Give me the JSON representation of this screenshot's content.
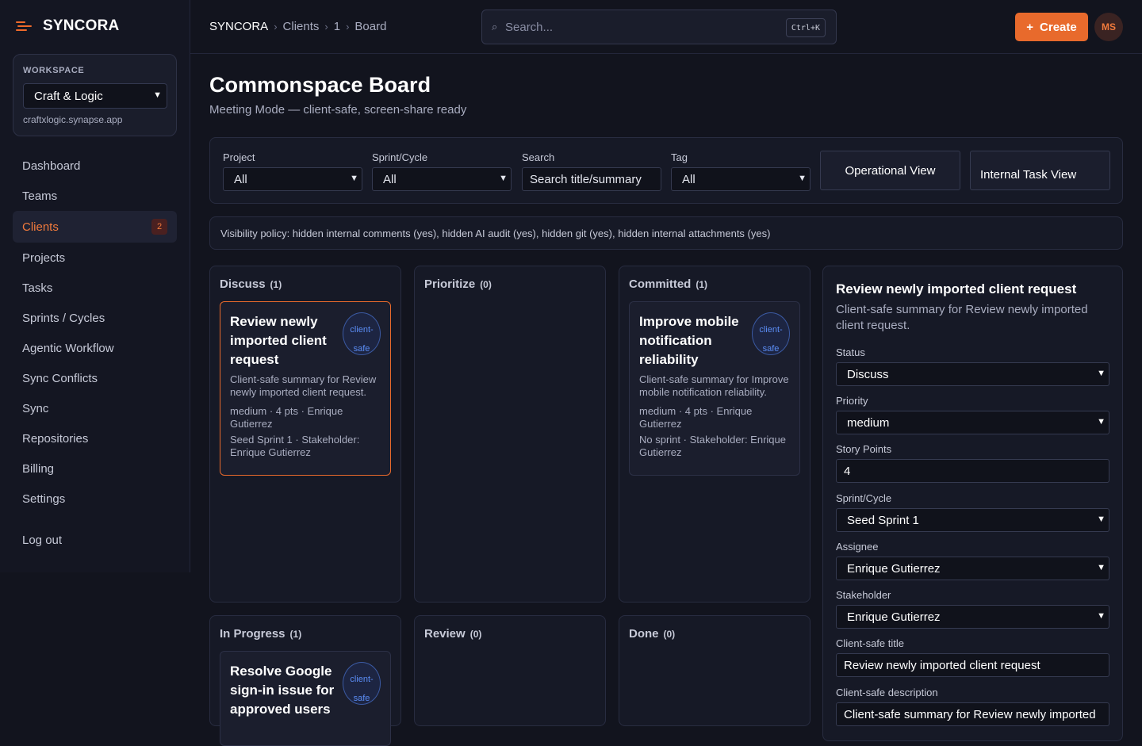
{
  "brand": {
    "name": "SYNCORA"
  },
  "workspace": {
    "label": "WORKSPACE",
    "selected": "Craft & Logic",
    "domain": "craftxlogic.synapse.app"
  },
  "nav": {
    "items": [
      {
        "label": "Dashboard"
      },
      {
        "label": "Teams"
      },
      {
        "label": "Clients",
        "badge": "2"
      },
      {
        "label": "Projects"
      },
      {
        "label": "Tasks"
      },
      {
        "label": "Sprints / Cycles"
      },
      {
        "label": "Agentic Workflow"
      },
      {
        "label": "Sync Conflicts"
      },
      {
        "label": "Sync"
      },
      {
        "label": "Repositories"
      },
      {
        "label": "Billing"
      },
      {
        "label": "Settings"
      }
    ],
    "logout": "Log out"
  },
  "breadcrumb": {
    "root": "SYNCORA",
    "sep": "›",
    "items": [
      "Clients",
      "1",
      "Board"
    ]
  },
  "search": {
    "icon": "⌕",
    "placeholder": "Search...",
    "shortcut": "Ctrl+K"
  },
  "actions": {
    "create_icon": "+",
    "create_label": "Create",
    "avatar_initials": "MS"
  },
  "page": {
    "title": "Commonspace Board",
    "subtitle": "Meeting Mode — client-safe, screen-share ready"
  },
  "filters": {
    "project": {
      "label": "Project",
      "value": "All"
    },
    "sprint": {
      "label": "Sprint/Cycle",
      "value": "All"
    },
    "search": {
      "label": "Search",
      "value": "Search title/summary"
    },
    "tag": {
      "label": "Tag",
      "value": "All"
    },
    "operational_view": "Operational View",
    "internal_view": "Internal Task View"
  },
  "policy": "Visibility policy: hidden internal comments (yes), hidden AI audit (yes), hidden git (yes), hidden internal attachments (yes)",
  "columns": [
    {
      "title": "Discuss",
      "count": "(1)"
    },
    {
      "title": "Prioritize",
      "count": "(0)"
    },
    {
      "title": "Committed",
      "count": "(1)"
    },
    {
      "title": "In Progress",
      "count": "(1)"
    },
    {
      "title": "Review",
      "count": "(0)"
    },
    {
      "title": "Done",
      "count": "(0)"
    }
  ],
  "cards": {
    "discuss": {
      "title": "Review newly imported client request",
      "pill": "client-safe",
      "summary": "Client-safe summary for Review newly imported client request.",
      "meta": "medium · 4 pts · Enrique Gutierrez",
      "meta2": "Seed Sprint 1 · Stakeholder: Enrique Gutierrez"
    },
    "committed": {
      "title": "Improve mobile notification reliability",
      "pill": "client-safe",
      "summary": "Client-safe summary for Improve mobile notification reliability.",
      "meta": "medium · 4 pts · Enrique Gutierrez",
      "meta2": "No sprint · Stakeholder: Enrique Gutierrez"
    },
    "in_progress": {
      "title": "Resolve Google sign-in issue for approved users",
      "pill": "client-safe"
    }
  },
  "detail": {
    "title": "Review newly imported client request",
    "subtitle": "Client-safe summary for Review newly imported client request.",
    "status": {
      "label": "Status",
      "value": "Discuss"
    },
    "priority": {
      "label": "Priority",
      "value": "medium"
    },
    "points": {
      "label": "Story Points",
      "value": "4"
    },
    "sprint": {
      "label": "Sprint/Cycle",
      "value": "Seed Sprint 1"
    },
    "assignee": {
      "label": "Assignee",
      "value": "Enrique Gutierrez"
    },
    "stakeholder": {
      "label": "Stakeholder",
      "value": "Enrique Gutierrez"
    },
    "client_title": {
      "label": "Client-safe title",
      "value": "Review newly imported client request"
    },
    "client_desc": {
      "label": "Client-safe description",
      "value": "Client-safe summary for Review newly imported"
    }
  },
  "colors": {
    "accent": "#e86a2c",
    "background": "#12141e",
    "panel": "#161926",
    "pill_blue": "#5b8df5"
  }
}
